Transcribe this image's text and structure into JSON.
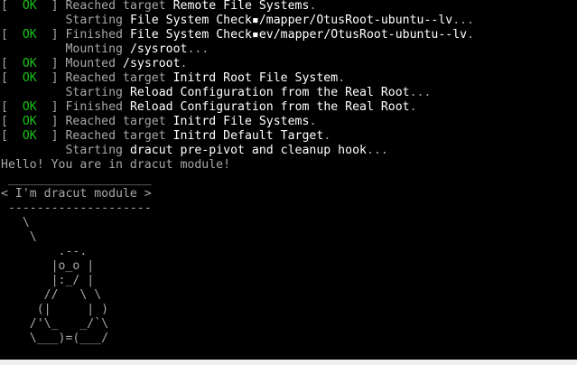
{
  "colors": {
    "background": "#000000",
    "text": "#a8a8a8",
    "ok": "#17c417",
    "highlight": "#ffffff"
  },
  "console": {
    "lines": [
      {
        "type": "status",
        "bracket_open": "[  ",
        "status": "OK",
        "bracket_close": "  ] ",
        "verb": "Reached target ",
        "name": "Remote File Systems",
        "tail": "."
      },
      {
        "type": "plain",
        "indent": "         ",
        "verb": "Starting ",
        "name": "File System Check▪/mapper/OtusRoot-ubuntu--lv",
        "tail": "..."
      },
      {
        "type": "status",
        "bracket_open": "[  ",
        "status": "OK",
        "bracket_close": "  ] ",
        "verb": "Finished ",
        "name": "File System Check▪ev/mapper/OtusRoot-ubuntu--lv",
        "tail": "."
      },
      {
        "type": "plain",
        "indent": "         ",
        "verb": "Mounting ",
        "name": "/sysroot",
        "tail": "..."
      },
      {
        "type": "status",
        "bracket_open": "[  ",
        "status": "OK",
        "bracket_close": "  ] ",
        "verb": "Mounted ",
        "name": "/sysroot",
        "tail": "."
      },
      {
        "type": "status",
        "bracket_open": "[  ",
        "status": "OK",
        "bracket_close": "  ] ",
        "verb": "Reached target ",
        "name": "Initrd Root File System",
        "tail": "."
      },
      {
        "type": "plain",
        "indent": "         ",
        "verb": "Starting ",
        "name": "Reload Configuration from the Real Root",
        "tail": "..."
      },
      {
        "type": "status",
        "bracket_open": "[  ",
        "status": "OK",
        "bracket_close": "  ] ",
        "verb": "Finished ",
        "name": "Reload Configuration from the Real Root",
        "tail": "."
      },
      {
        "type": "status",
        "bracket_open": "[  ",
        "status": "OK",
        "bracket_close": "  ] ",
        "verb": "Reached target ",
        "name": "Initrd File Systems",
        "tail": "."
      },
      {
        "type": "status",
        "bracket_open": "[  ",
        "status": "OK",
        "bracket_close": "  ] ",
        "verb": "Reached target ",
        "name": "Initrd Default Target",
        "tail": "."
      },
      {
        "type": "plain",
        "indent": "         ",
        "verb": "Starting ",
        "name": "dracut pre-pivot and cleanup hook",
        "tail": "..."
      },
      {
        "type": "raw",
        "text": "Hello! You are in dracut module!"
      },
      {
        "type": "raw",
        "text": " ____________________"
      },
      {
        "type": "raw",
        "text": "< I'm dracut module >"
      },
      {
        "type": "raw",
        "text": " --------------------"
      },
      {
        "type": "raw",
        "text": "   \\"
      },
      {
        "type": "raw",
        "text": "    \\"
      },
      {
        "type": "raw",
        "text": "        .--."
      },
      {
        "type": "raw",
        "text": "       |o_o |"
      },
      {
        "type": "raw",
        "text": "       |:_/ |"
      },
      {
        "type": "raw",
        "text": "      //   \\ \\"
      },
      {
        "type": "raw",
        "text": "     (|     | )"
      },
      {
        "type": "raw",
        "text": "    /'\\_   _/`\\"
      },
      {
        "type": "raw",
        "text": "    \\___)=(___/"
      }
    ]
  }
}
